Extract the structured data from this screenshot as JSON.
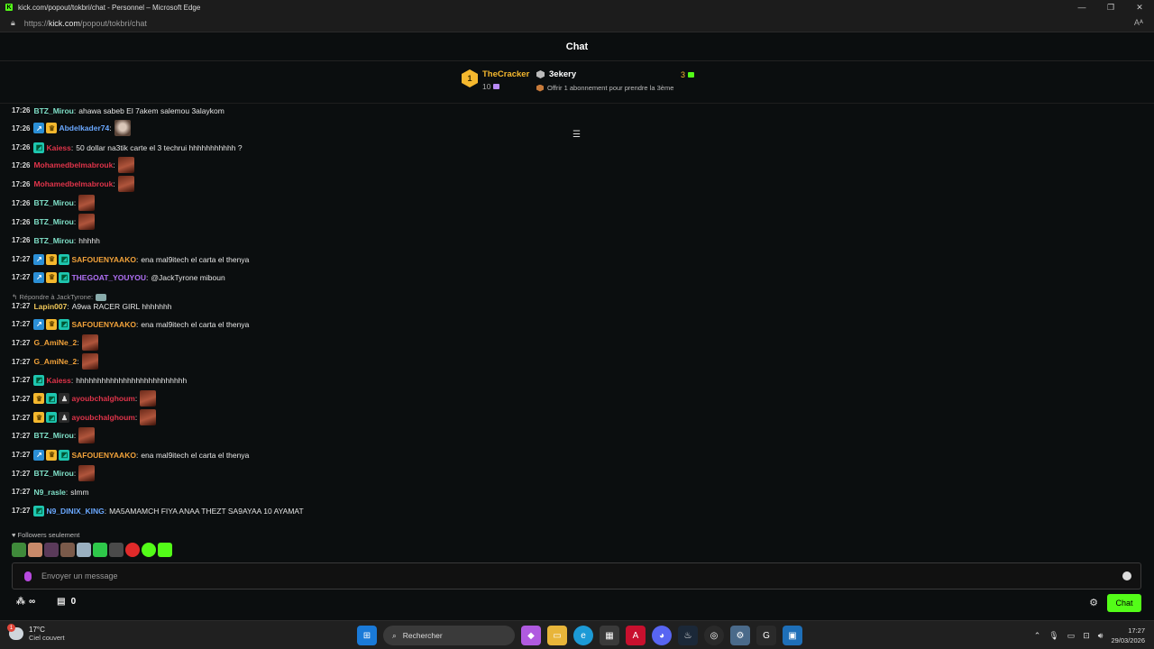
{
  "window": {
    "title": "kick.com/popout/tokbri/chat - Personnel – Microsoft Edge",
    "url_prefix": "https://",
    "url_domain": "kick.com",
    "url_path": "/popout/tokbri/chat"
  },
  "chat": {
    "header": "Chat",
    "leaderboard": {
      "rank": "1",
      "user": "TheCracker",
      "count": "10"
    },
    "goal": {
      "user": "3ekery",
      "count": "3",
      "text": "Offrir 1 abonnement pour prendre la 3ème"
    },
    "messages": [
      {
        "time": "17:26",
        "badges": [],
        "user": "BTZ_Mirou",
        "color": "#7fe0c8",
        "text": "ahawa sabeb El 7akem salemou 3alaykom",
        "emote": ""
      },
      {
        "time": "17:26",
        "badges": [
          "blue",
          "gold"
        ],
        "user": "Abdelkader74",
        "color": "#6aa8ff",
        "text": "",
        "emote": "cat"
      },
      {
        "time": "17:26",
        "badges": [
          "teal"
        ],
        "user": "Kaiess",
        "color": "#e0344a",
        "text": "50 dollar na3tik carte el 3 techrui hhhhhhhhhhh ?",
        "emote": ""
      },
      {
        "time": "17:26",
        "badges": [],
        "user": "Mohamedbelmabrouk",
        "color": "#e0344a",
        "text": "",
        "emote": "red"
      },
      {
        "time": "17:26",
        "badges": [],
        "user": "Mohamedbelmabrouk",
        "color": "#e0344a",
        "text": "",
        "emote": "red"
      },
      {
        "time": "17:26",
        "badges": [],
        "user": "BTZ_Mirou",
        "color": "#7fe0c8",
        "text": "",
        "emote": "red"
      },
      {
        "time": "17:26",
        "badges": [],
        "user": "BTZ_Mirou",
        "color": "#7fe0c8",
        "text": "",
        "emote": "red"
      },
      {
        "time": "17:26",
        "badges": [],
        "user": "BTZ_Mirou",
        "color": "#7fe0c8",
        "text": "hhhhh",
        "emote": ""
      },
      {
        "time": "17:27",
        "badges": [
          "blue",
          "gold",
          "teal"
        ],
        "user": "SAFOUENYAAKO",
        "color": "#f2a23a",
        "text": "ena mal9itech el carta el thenya",
        "emote": ""
      },
      {
        "time": "17:27",
        "badges": [
          "blue",
          "gold",
          "teal"
        ],
        "user": "THEGOAT_YOUYOU",
        "color": "#b070f5",
        "text": "@JackTyrone miboun",
        "emote": ""
      },
      {
        "time": "17:27",
        "badges": [],
        "user": "Lapin007",
        "color": "#f2c95a",
        "text": "A9wa RACER GIRL hhhhhhh",
        "emote": ""
      },
      {
        "time": "17:27",
        "badges": [
          "blue",
          "gold",
          "teal"
        ],
        "user": "SAFOUENYAAKO",
        "color": "#f2a23a",
        "text": "ena mal9itech el carta el thenya",
        "emote": ""
      },
      {
        "time": "17:27",
        "badges": [],
        "user": "G_AmiNe_2",
        "color": "#f2a23a",
        "text": "",
        "emote": "red"
      },
      {
        "time": "17:27",
        "badges": [],
        "user": "G_AmiNe_2",
        "color": "#f2a23a",
        "text": "",
        "emote": "red"
      },
      {
        "time": "17:27",
        "badges": [
          "teal"
        ],
        "user": "Kaiess",
        "color": "#e0344a",
        "text": "hhhhhhhhhhhhhhhhhhhhhhhhhh",
        "emote": ""
      },
      {
        "time": "17:27",
        "badges": [
          "gold",
          "teal",
          "dark"
        ],
        "user": "ayoubchalghoum",
        "color": "#e0344a",
        "text": "",
        "emote": "red"
      },
      {
        "time": "17:27",
        "badges": [
          "gold",
          "teal",
          "dark"
        ],
        "user": "ayoubchalghoum",
        "color": "#e0344a",
        "text": "",
        "emote": "red"
      },
      {
        "time": "17:27",
        "badges": [],
        "user": "BTZ_Mirou",
        "color": "#7fe0c8",
        "text": "",
        "emote": "red"
      },
      {
        "time": "17:27",
        "badges": [
          "blue",
          "gold",
          "teal"
        ],
        "user": "SAFOUENYAAKO",
        "color": "#f2a23a",
        "text": "ena mal9itech el carta el thenya",
        "emote": ""
      },
      {
        "time": "17:27",
        "badges": [],
        "user": "BTZ_Mirou",
        "color": "#7fe0c8",
        "text": "",
        "emote": "red"
      },
      {
        "time": "17:27",
        "badges": [],
        "user": "N9_rasle",
        "color": "#7fe0c8",
        "text": "slmm",
        "emote": ""
      },
      {
        "time": "17:27",
        "badges": [
          "teal"
        ],
        "user": "N9_DINIX_KING",
        "color": "#6aa8ff",
        "text": "MA5AMAMCH FIYA ANAA THEZT SA9AYAA 10 AYAMAT",
        "emote": ""
      }
    ],
    "reply_label": "Répondre à JackTyrone:",
    "followers_only": "Followers seulement",
    "input_placeholder": "Envoyer un message",
    "infinity": "∞",
    "store_count": "0",
    "send_button": "Chat"
  },
  "taskbar": {
    "temperature": "17°C",
    "weather": "Ciel couvert",
    "weather_badge": "1",
    "search": "Rechercher",
    "time": "17:27",
    "date": "29/03/2026"
  }
}
